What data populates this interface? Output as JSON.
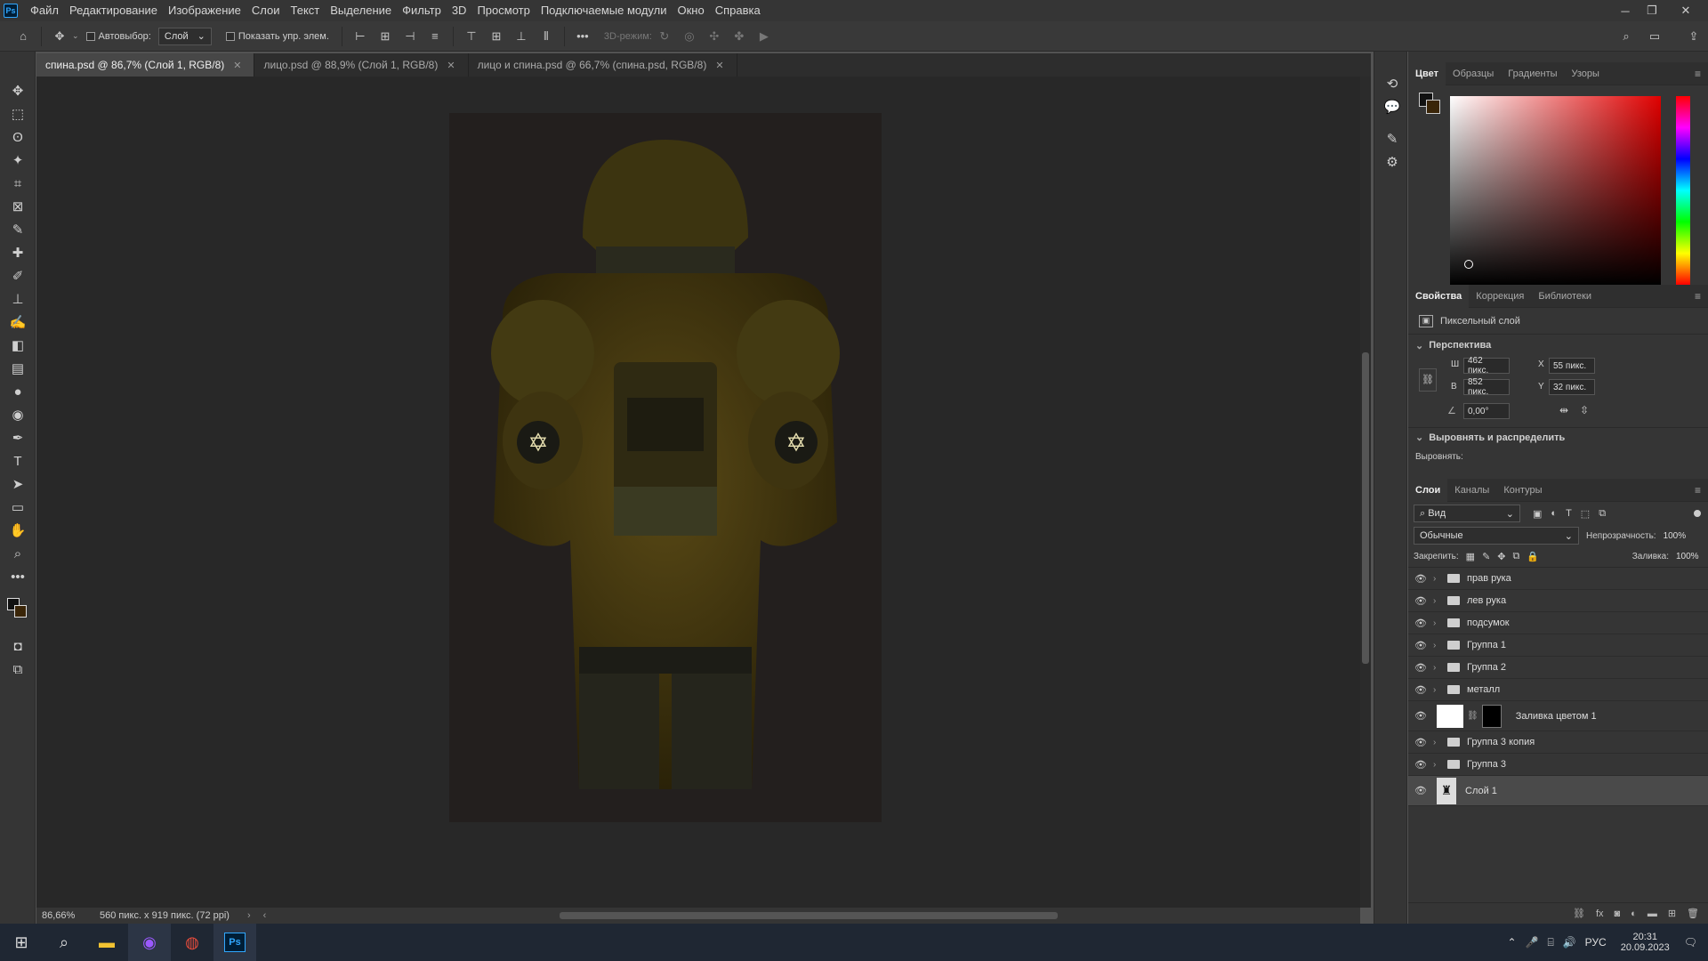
{
  "menu": [
    "Файл",
    "Редактирование",
    "Изображение",
    "Слои",
    "Текст",
    "Выделение",
    "Фильтр",
    "3D",
    "Просмотр",
    "Подключаемые модули",
    "Окно",
    "Справка"
  ],
  "app_logo": "Ps",
  "options": {
    "autoselect_label": "Автовыбор:",
    "autoselect_value": "Слой",
    "show_transform_label": "Показать упр. элем.",
    "mode_3d_label": "3D-режим:"
  },
  "tabs": [
    {
      "label": "спина.psd @ 86,7% (Слой 1, RGB/8)",
      "active": true
    },
    {
      "label": "лицо.psd @ 88,9% (Слой 1, RGB/8)",
      "active": false
    },
    {
      "label": "лицо и спина.psd @ 66,7% (спина.psd, RGB/8)",
      "active": false
    }
  ],
  "status": {
    "zoom": "86,66%",
    "doc_info": "560 пикс. x 919 пикс. (72 ppi)"
  },
  "color_panel": {
    "tabs": [
      "Цвет",
      "Образцы",
      "Градиенты",
      "Узоры"
    ]
  },
  "properties_panel": {
    "tabs": [
      "Свойства",
      "Коррекция",
      "Библиотеки"
    ],
    "layer_type": "Пиксельный слой",
    "section_perspective": "Перспектива",
    "w_label": "Ш",
    "w_value": "462 пикс.",
    "h_label": "В",
    "h_value": "852 пикс.",
    "x_label": "X",
    "x_value": "55 пикс.",
    "y_label": "Y",
    "y_value": "32 пикс.",
    "angle_value": "0,00°",
    "section_align": "Выровнять и распределить",
    "align_label": "Выровнять:"
  },
  "layers_panel": {
    "tabs": [
      "Слои",
      "Каналы",
      "Контуры"
    ],
    "filter_label": "Вид",
    "blend_mode": "Обычные",
    "opacity_label": "Непрозрачность:",
    "opacity_value": "100%",
    "lock_label": "Закрепить:",
    "fill_label": "Заливка:",
    "fill_value": "100%",
    "layers": [
      {
        "name": "прав рука",
        "kind": "group"
      },
      {
        "name": "лев рука",
        "kind": "group"
      },
      {
        "name": "подсумок",
        "kind": "group"
      },
      {
        "name": "Группа 1",
        "kind": "group"
      },
      {
        "name": "Группа 2",
        "kind": "group"
      },
      {
        "name": "металл",
        "kind": "group"
      },
      {
        "name": "Заливка цветом 1",
        "kind": "fill"
      },
      {
        "name": "Группа 3 копия",
        "kind": "group"
      },
      {
        "name": "Группа 3",
        "kind": "group"
      },
      {
        "name": "Слой 1",
        "kind": "pixel",
        "selected": true
      }
    ]
  },
  "taskbar": {
    "lang": "РУС",
    "time": "20:31",
    "date": "20.09.2023"
  }
}
